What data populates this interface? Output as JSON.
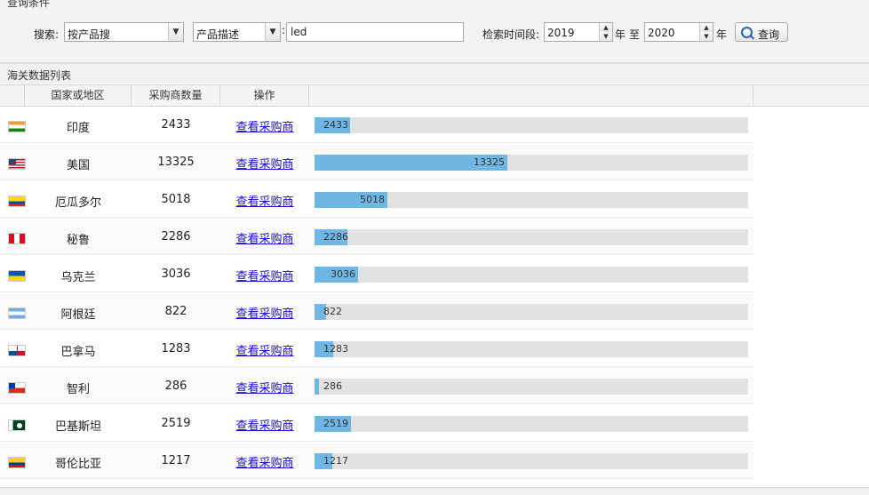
{
  "query_panel": {
    "title": "查询条件",
    "search_label": "搜索:",
    "search_mode": "按产品搜",
    "field_mode": "产品描述",
    "colon": ":",
    "keyword": "led",
    "time_label": "检索时间段:",
    "year_from": "2019",
    "year_unit_1": "年",
    "to": "至",
    "year_to": "2020",
    "year_unit_2": "年",
    "query_button": "查询"
  },
  "list": {
    "title": "海关数据列表",
    "columns": [
      "国家或地区",
      "采购商数量",
      "操作"
    ],
    "link_text": "查看采购商",
    "bar_max": 30000,
    "rows": [
      {
        "country": "印度",
        "count": "2433",
        "value": 2433,
        "flag": "india"
      },
      {
        "country": "美国",
        "count": "13325",
        "value": 13325,
        "flag": "usa"
      },
      {
        "country": "厄瓜多尔",
        "count": "5018",
        "value": 5018,
        "flag": "ecuador"
      },
      {
        "country": "秘鲁",
        "count": "2286",
        "value": 2286,
        "flag": "peru"
      },
      {
        "country": "乌克兰",
        "count": "3036",
        "value": 3036,
        "flag": "ukraine"
      },
      {
        "country": "阿根廷",
        "count": "822",
        "value": 822,
        "flag": "argentina"
      },
      {
        "country": "巴拿马",
        "count": "1283",
        "value": 1283,
        "flag": "panama"
      },
      {
        "country": "智利",
        "count": "286",
        "value": 286,
        "flag": "chile"
      },
      {
        "country": "巴基斯坦",
        "count": "2519",
        "value": 2519,
        "flag": "pakistan"
      },
      {
        "country": "哥伦比亚",
        "count": "1217",
        "value": 1217,
        "flag": "colombia"
      }
    ]
  }
}
